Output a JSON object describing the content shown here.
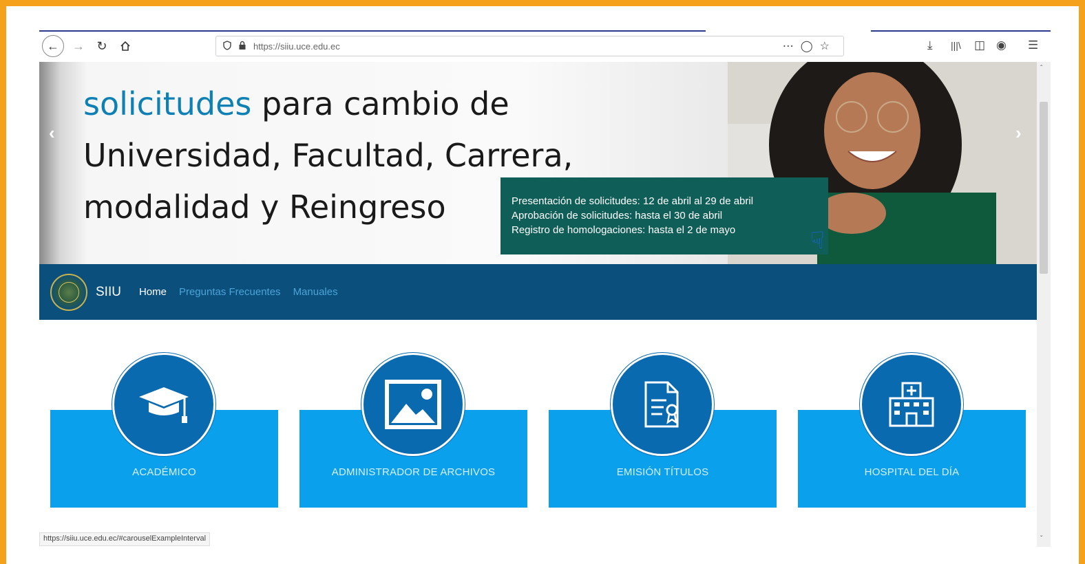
{
  "browser": {
    "url": "https://siiu.uce.edu.ec",
    "status_url": "https://siiu.uce.edu.ec/#carouselExampleInterval",
    "icons": [
      "back-icon",
      "forward-icon",
      "reload-icon",
      "home-icon",
      "shield-icon",
      "lock-icon",
      "more-icon",
      "pocket-icon",
      "star-icon",
      "download-icon",
      "library-icon",
      "sidebar-icon",
      "account-icon",
      "menu-icon"
    ]
  },
  "banner": {
    "headline_accent": "solicitudes",
    "headline_line1_rest": " para cambio de",
    "headline_line2": "Universidad, Facultad, Carrera,",
    "headline_line3": "modalidad y Reingreso",
    "info_line1": "Presentación  de  solicitudes: 12 de abril al 29 de abril",
    "info_line2": "Aprobación de solicitudes: hasta el 30 de abril",
    "info_line3": "Registro de homologaciones: hasta el 2 de mayo",
    "prev_glyph": "‹",
    "next_glyph": "›"
  },
  "navbar": {
    "brand": "SIIU",
    "links": [
      "Home",
      "Preguntas Frecuentes",
      "Manuales"
    ]
  },
  "cards": [
    {
      "label": "ACADÉMICO",
      "icon": "graduation-cap-icon"
    },
    {
      "label": "ADMINISTRADOR DE ARCHIVOS",
      "icon": "image-icon"
    },
    {
      "label": "EMISIÓN TÍTULOS",
      "icon": "certificate-document-icon"
    },
    {
      "label": "HOSPITAL DEL DÍA",
      "icon": "hospital-icon"
    }
  ],
  "colors": {
    "frame": "#f5a11c",
    "navbar": "#0b4f7c",
    "card": "#0aa0ec",
    "circle": "#0a6ab0",
    "accent_text": "#0f80b4",
    "info_box": "#0f5e58"
  }
}
